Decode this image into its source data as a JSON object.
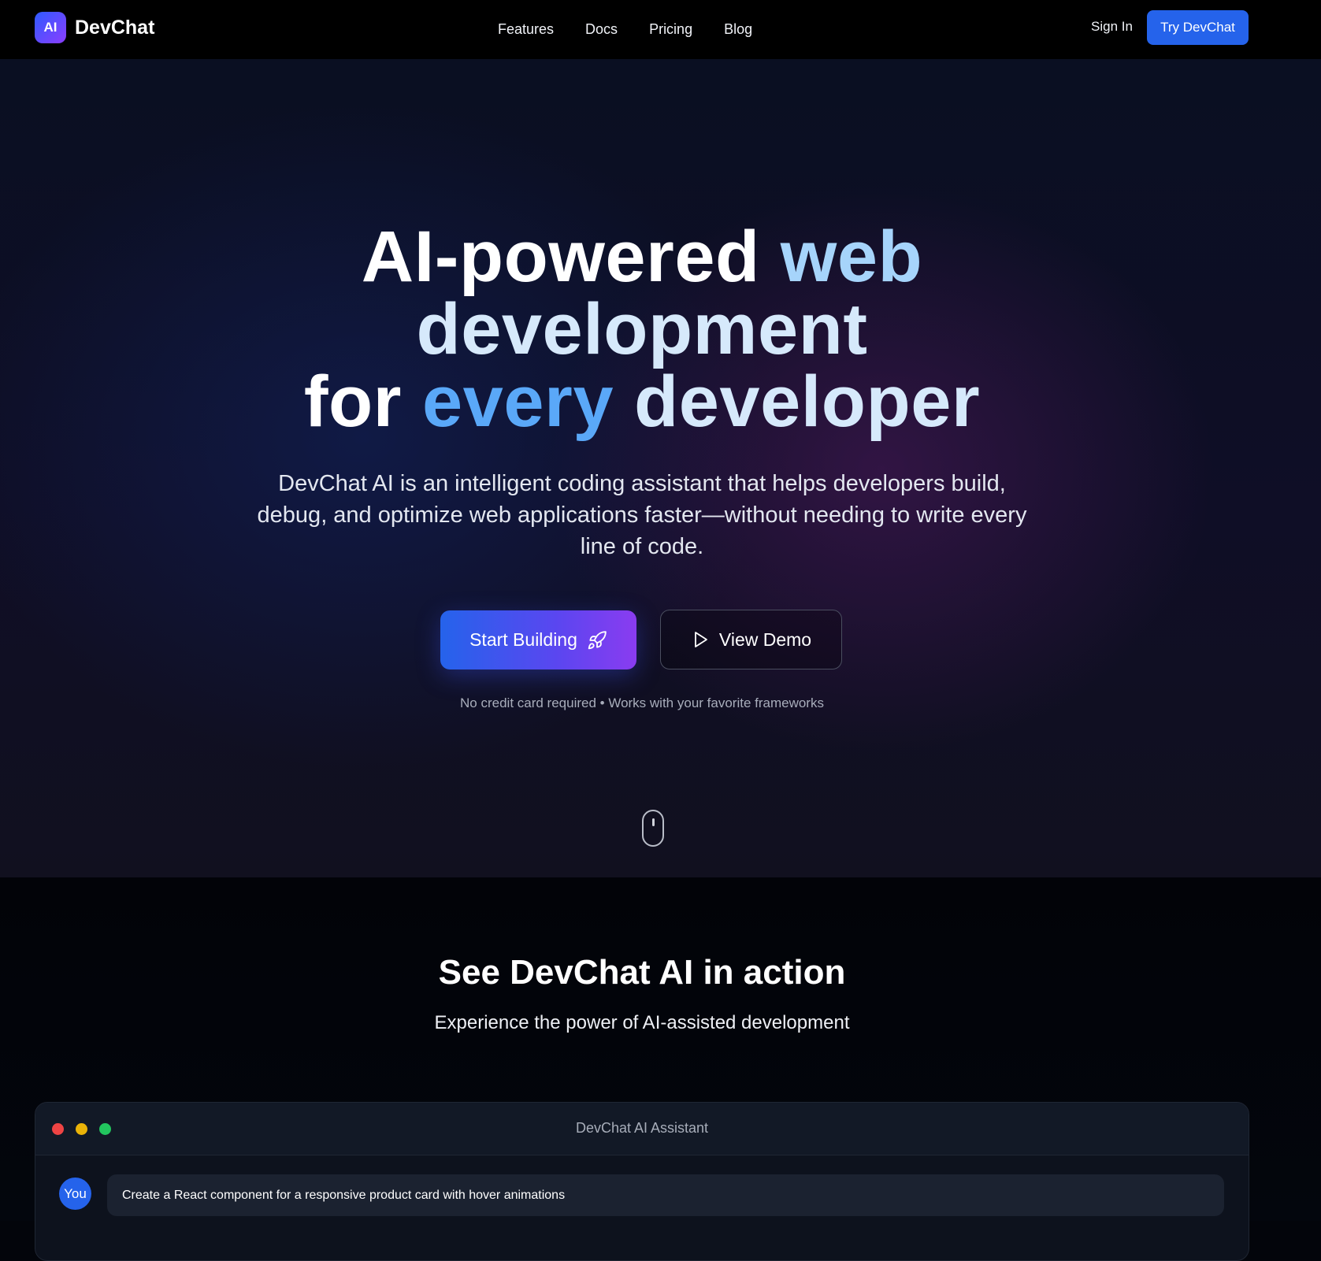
{
  "nav": {
    "logo_text": "AI",
    "brand": "DevChat",
    "links": [
      "Features",
      "Docs",
      "Pricing",
      "Blog"
    ],
    "sign_in": "Sign In",
    "cta": "Try DevChat"
  },
  "hero": {
    "title_line1_a": "AI-powered ",
    "title_line1_b": "web",
    "title_line2": "development",
    "title_line3_a": "for ",
    "title_line3_b": "every",
    "title_line3_c": " developer",
    "subtitle": "DevChat AI is an intelligent coding assistant that helps developers build, debug, and optimize web applications faster—without needing to write every line of code.",
    "primary_button": "Start Building",
    "secondary_button": "View Demo",
    "note": "No credit card required • Works with your favorite frameworks"
  },
  "demo": {
    "title": "See DevChat AI in action",
    "subtitle": "Experience the power of AI-assisted development",
    "window_title": "DevChat AI Assistant",
    "user_label": "You",
    "user_message": "Create a React component for a responsive product card with hover animations"
  },
  "icons": {
    "rocket": "rocket-icon",
    "play": "play-icon",
    "scroll": "mouse-scroll-icon"
  },
  "colors": {
    "accent": "#2563eb",
    "gradient_end": "#8a3cf0",
    "highlight": "#a6d4fb"
  }
}
